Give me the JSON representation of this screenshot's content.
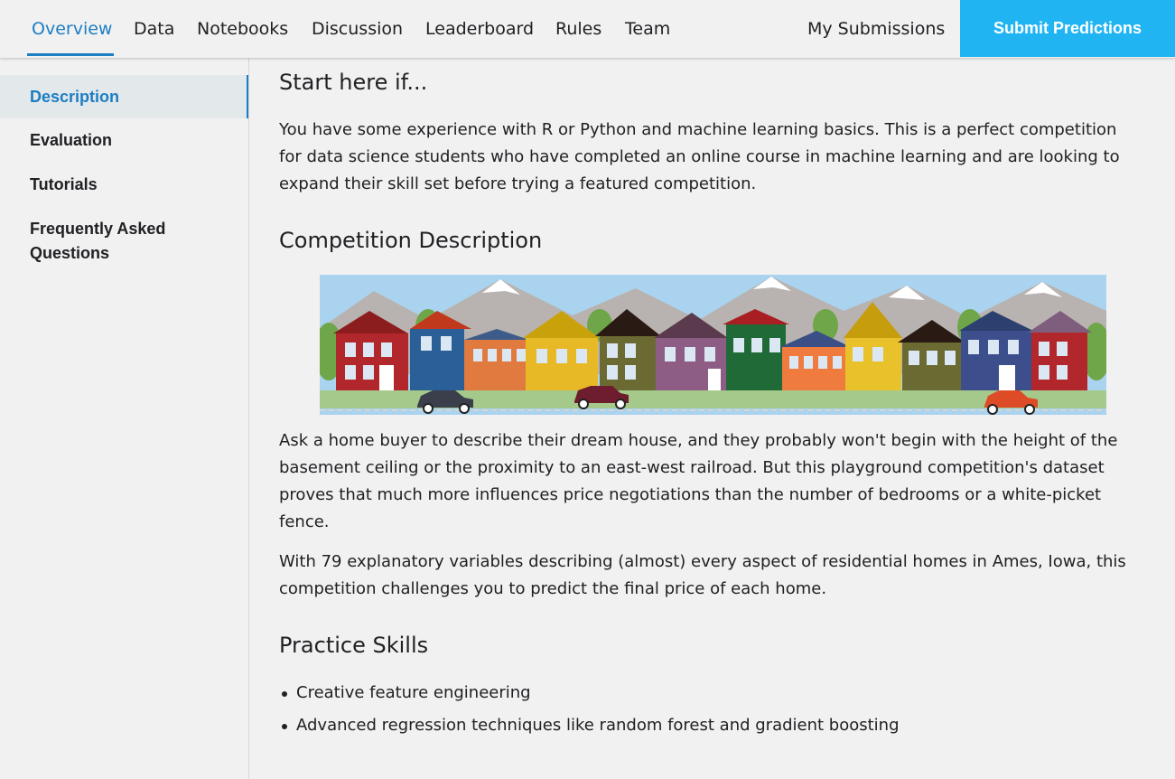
{
  "nav": {
    "tabs": [
      {
        "label": "Overview",
        "active": true
      },
      {
        "label": "Data"
      },
      {
        "label": "Notebooks"
      },
      {
        "label": "Discussion"
      },
      {
        "label": "Leaderboard"
      },
      {
        "label": "Rules"
      },
      {
        "label": "Team"
      }
    ],
    "my_submissions": "My Submissions",
    "submit_label": "Submit Predictions"
  },
  "sidebar": {
    "items": [
      {
        "label": "Description",
        "active": true
      },
      {
        "label": "Evaluation"
      },
      {
        "label": "Tutorials"
      },
      {
        "label": "Frequently Asked Questions"
      }
    ]
  },
  "main": {
    "start_heading": "Start here if...",
    "start_text": "You have some experience with R or Python and machine learning basics. This is a perfect competition for data science students who have completed an online course in machine learning and are looking to expand their skill set before trying a featured competition.",
    "description_heading": "Competition Description",
    "description_p1": "Ask a home buyer to describe their dream house, and they probably won't begin with the height of the basement ceiling or the proximity to an east-west railroad. But this playground competition's dataset proves that much more influences price negotiations than the number of bedrooms or a white-picket fence.",
    "description_p2": "With 79 explanatory variables describing (almost) every aspect of residential homes in Ames, Iowa, this competition challenges you to predict the final price of each home.",
    "skills_heading": "Practice Skills",
    "skills": [
      "Creative feature engineering",
      "Advanced regression techniques like random forest and gradient boosting"
    ]
  },
  "colors": {
    "accent": "#1c7ec3",
    "submit_bg": "#20b4f2",
    "background": "#f1f1f1"
  }
}
